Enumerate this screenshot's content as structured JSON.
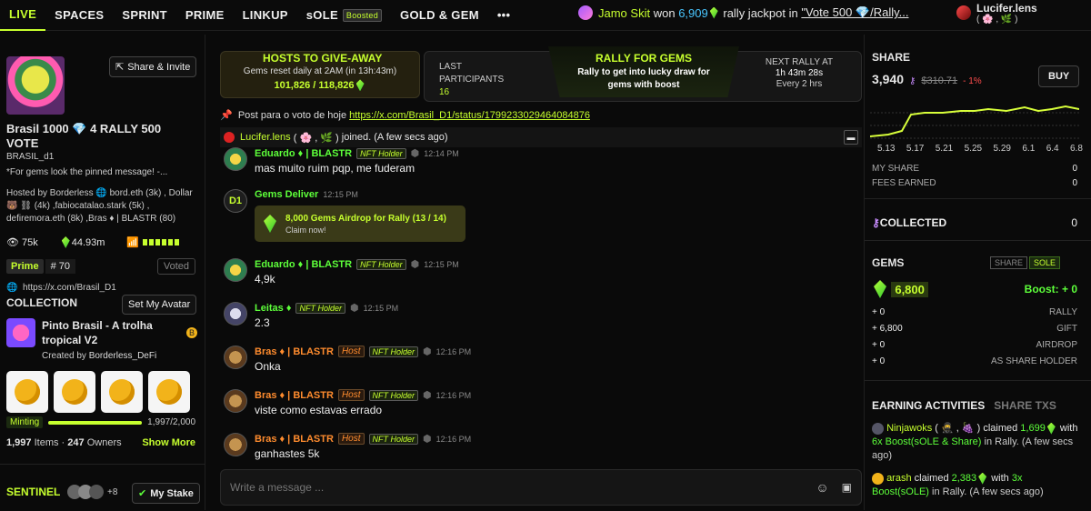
{
  "nav": {
    "tabs": [
      "LIVE",
      "SPACES",
      "SPRINT",
      "PRIME",
      "LINKUP",
      "sOLE",
      "GOLD & GEM"
    ],
    "boosted_badge": "Boosted",
    "more": "•••",
    "ticker": {
      "user": "Jamo Skit",
      "verb": "won",
      "amount": "6,909",
      "text": "rally jackpot in",
      "link": "\"Vote 500 💎/Rally..."
    },
    "account": {
      "name": "Lucifer.lens",
      "sub": "( 🌸 , 🌿 )"
    }
  },
  "left": {
    "share_invite": "Share & Invite",
    "title": "Brasil 1000 💎 4 RALLY 500 VOTE",
    "handle": "BRASIL_d1",
    "desc": "*For gems look the pinned message! -...",
    "hosted": "Hosted by Borderless 🌐 bord.eth (3k) , Dollar 🐻 ⛓ (4k) ,fabiocatalao.stark (5k) , defiremora.eth (8k) ,Bras ♦ | BLASTR (80)",
    "views": "75k",
    "gems": "44.93m",
    "prime_label": "Prime",
    "prime_rank": "# 70",
    "voted": "Voted",
    "url": "https://x.com/Brasil_D1",
    "collection_label": "COLLECTION",
    "set_avatar": "Set My Avatar",
    "collection_name": "Pinto Brasil - A trolha tropical V2",
    "created_by": "Created by",
    "creator": "Borderless_DeFi",
    "minting": "Minting",
    "mint_count": "1,997/2,000",
    "mint_fraction": 0.9985,
    "items_count": "1,997",
    "items_label": "Items ·",
    "owners_count": "247",
    "owners_label": "Owners",
    "show_more": "Show More",
    "sentinel": "SENTINEL",
    "sentinel_more": "+8",
    "my_stake": "My Stake"
  },
  "center": {
    "hosts_title": "HOSTS TO GIVE-AWAY",
    "hosts_reset": "Gems reset daily at 2AM (in 13h:43m)",
    "hosts_value": "101,826 / 118,826",
    "last_label": "LAST PARTICIPANTS",
    "last_value": "16",
    "rally_title": "RALLY FOR GEMS",
    "rally_desc": "Rally to get into lucky draw for gems with boost",
    "next_label": "NEXT RALLY AT",
    "next_time": "1h 43m 28s",
    "next_every": "Every 2 hrs",
    "pinned_text": "Post para o voto de hoje",
    "pinned_link": "https://x.com/Brasil_D1/status/1799233029464084876",
    "join_user": "Lucifer.lens",
    "join_sub": "( 🌸 , 🌿 )",
    "join_text": "joined. (A few secs ago)",
    "messages": [
      {
        "name": "Eduardo ♦ | BLASTR",
        "tag": "NFT Holder",
        "time": "12:14 PM",
        "text": "mas muito ruim pqp, me fuderam"
      },
      {
        "name": "Gems Deliver",
        "time": "12:15 PM",
        "drop_title": "8,000 Gems Airdrop for Rally (13 / 14)",
        "drop_cta": "Claim now!"
      },
      {
        "name": "Eduardo ♦ | BLASTR",
        "tag": "NFT Holder",
        "time": "12:15 PM",
        "text": "4,9k"
      },
      {
        "name": "Leitas ♦",
        "tag": "NFT Holder",
        "time": "12:15 PM",
        "text": "2.3"
      },
      {
        "name": "Bras ♦ | BLASTR",
        "host": "Host",
        "tag": "NFT Holder",
        "time": "12:16 PM",
        "text": "Onka"
      },
      {
        "name": "Bras ♦ | BLASTR",
        "host": "Host",
        "tag": "NFT Holder",
        "time": "12:16 PM",
        "text": "viste como estavas errado"
      },
      {
        "name": "Bras ♦ | BLASTR",
        "host": "Host",
        "tag": "NFT Holder",
        "time": "12:16 PM",
        "text": "ganhastes 5k"
      }
    ],
    "d1_label": "D1",
    "input_placeholder": "Write a message ..."
  },
  "right": {
    "share_label": "SHARE",
    "share_count": "3,940",
    "share_price": "$310.71",
    "share_change": "- 1%",
    "buy": "BUY",
    "chart_dates": [
      "5.13",
      "5.17",
      "5.21",
      "5.25",
      "5.29",
      "6.1",
      "6.4",
      "6.8"
    ],
    "my_share_label": "MY SHARE",
    "my_share": "0",
    "fees_label": "FEES EARNED",
    "fees": "0",
    "collected_label": "COLLECTED",
    "collected": "0",
    "gems_label": "GEMS",
    "toggle_share": "SHARE",
    "toggle_sole": "SOLE",
    "gems_value": "6,800",
    "boost": "Boost: + 0",
    "breakdown": [
      {
        "value": "+ 0",
        "label": "RALLY"
      },
      {
        "value": "+ 6,800",
        "label": "GIFT"
      },
      {
        "value": "+ 0",
        "label": "AIRDROP"
      },
      {
        "value": "+ 0",
        "label": "AS SHARE HOLDER"
      }
    ],
    "earning_tab": "EARNING ACTIVITIES",
    "txs_tab": "SHARE TXS",
    "act1_user": "Ninjawoks",
    "act1_sub": "( 🥷 , 🍇 )",
    "act1_claimed": "claimed",
    "act1_amount": "1,699",
    "act1_with": "with",
    "act1_boost": "6x Boost(sOLE & Share)",
    "act1_in": "in Rally. (A few secs ago)",
    "act2_user": "arash",
    "act2_claimed": "claimed",
    "act2_amount": "2,383",
    "act2_with": "with",
    "act2_boost": "3x Boost(sOLE)",
    "act2_in": "in Rally. (A few secs ago)"
  }
}
